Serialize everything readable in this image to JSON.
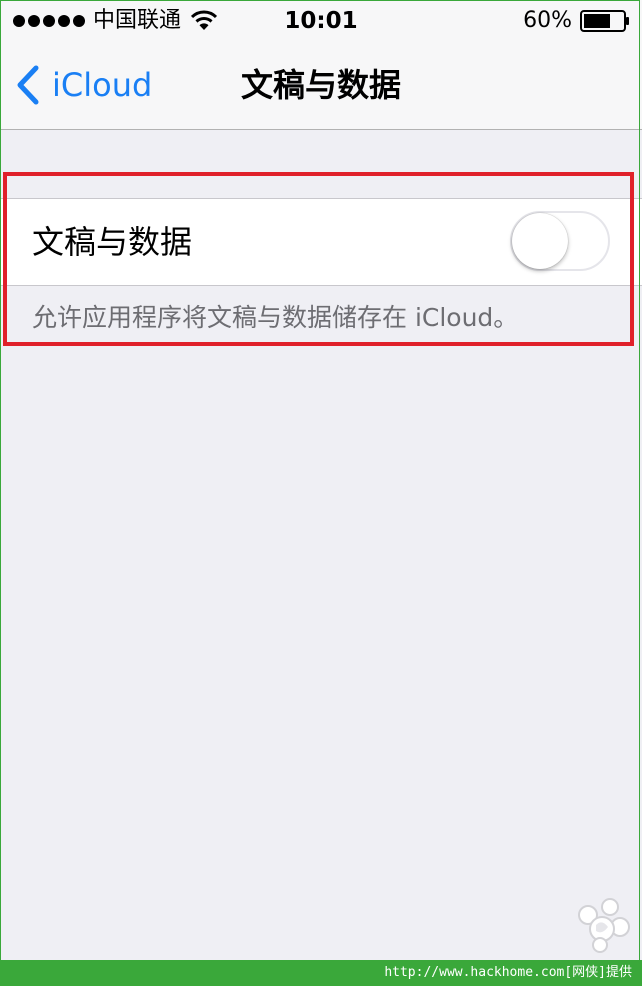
{
  "status_bar": {
    "carrier": "中国联通",
    "time": "10:01",
    "battery_percent": "60%"
  },
  "nav_bar": {
    "back_label": "iCloud",
    "title": "文稿与数据"
  },
  "settings": {
    "row_label": "文稿与数据",
    "toggle_state": "off",
    "footer_note": "允许应用程序将文稿与数据储存在 iCloud。"
  },
  "footer": {
    "watermark_text": "http://www.hackhome.com[网侠]提供"
  },
  "colors": {
    "accent": "#1a7ff4",
    "background": "#efeff4",
    "highlight": "#e0202a",
    "frame_green": "#3aa83a"
  },
  "icons": [
    "signal-icon",
    "wifi-icon",
    "battery-icon",
    "back-chevron-icon",
    "watermark-icon"
  ]
}
